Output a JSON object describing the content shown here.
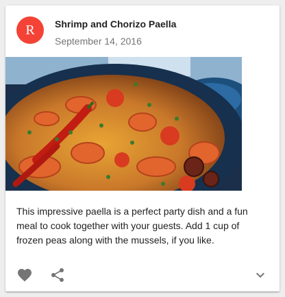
{
  "card": {
    "avatar_letter": "R",
    "avatar_color": "#f44336",
    "title": "Shrimp and Chorizo Paella",
    "subheader": "September 14, 2016",
    "description": "This impressive paella is a perfect party dish and a fun meal to cook together with your guests. Add 1 cup of frozen peas along with the mussels, if you like."
  },
  "actions": {
    "favorite_icon": "heart-icon",
    "share_icon": "share-icon",
    "expand_icon": "chevron-down-icon",
    "icon_color": "#757575"
  }
}
